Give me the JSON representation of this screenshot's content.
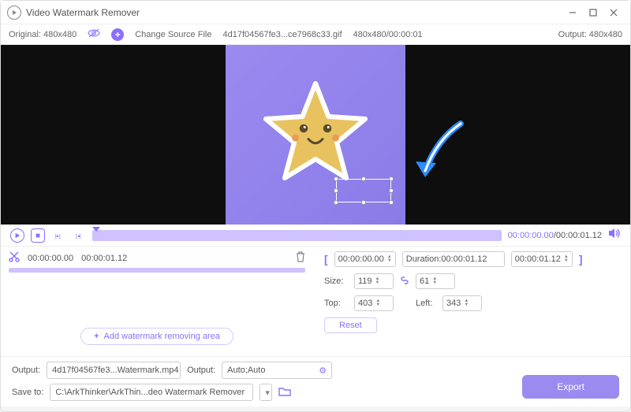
{
  "titlebar": {
    "title": "Video Watermark Remover"
  },
  "infobar": {
    "original": "Original: 480x480",
    "change_source": "Change Source File",
    "filename": "4d17f04567fe3...ce7968c33.gif",
    "dims_time": "480x480/00:00:01",
    "output": "Output: 480x480"
  },
  "playback": {
    "current": "00:00:00.00",
    "total": "00:00:01.12"
  },
  "clip": {
    "start": "00:00:00.00",
    "end": "00:00:01.12"
  },
  "range": {
    "start": "00:00:00.00",
    "duration_label": "Duration:00:00:01.12",
    "end": "00:00:01.12"
  },
  "size": {
    "label": "Size:",
    "w": "119",
    "h": "61"
  },
  "pos": {
    "top_label": "Top:",
    "top": "403",
    "left_label": "Left:",
    "left": "343"
  },
  "buttons": {
    "reset": "Reset",
    "add_area": "Add watermark removing area",
    "export": "Export"
  },
  "output": {
    "label": "Output:",
    "filename": "4d17f04567fe3...Watermark.mp4",
    "label2": "Output:",
    "preset": "Auto;Auto"
  },
  "save": {
    "label": "Save to:",
    "path": "C:\\ArkThinker\\ArkThin...deo Watermark Remover"
  }
}
